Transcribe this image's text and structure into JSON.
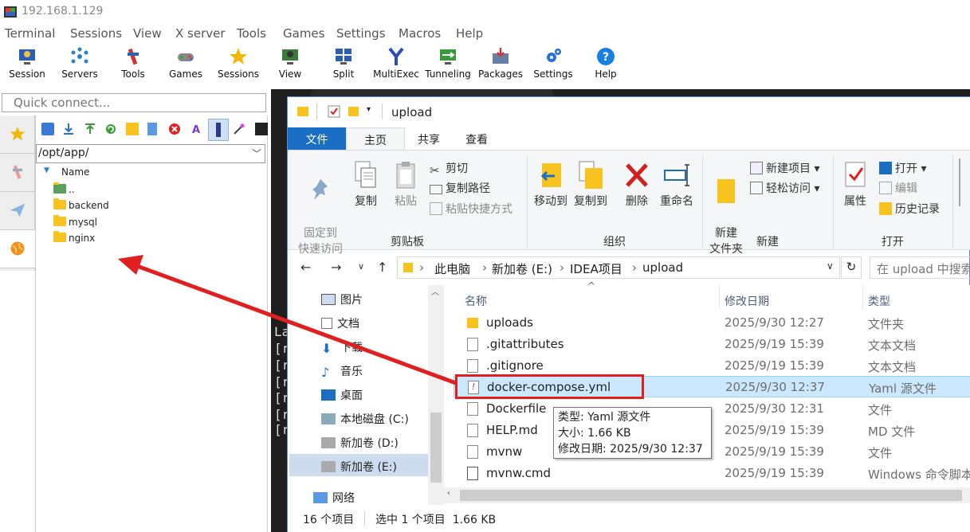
{
  "app": {
    "title": "192.168.1.129"
  },
  "menu": [
    "Terminal",
    "Sessions",
    "View",
    "X server",
    "Tools",
    "Games",
    "Settings",
    "Macros",
    "Help"
  ],
  "toolbar": [
    "Session",
    "Servers",
    "Tools",
    "Games",
    "Sessions",
    "View",
    "Split",
    "MultiExec",
    "Tunneling",
    "Packages",
    "Settings",
    "Help"
  ],
  "quick_connect": {
    "placeholder": "Quick connect..."
  },
  "sftp": {
    "path": "/opt/app/",
    "header": "Name",
    "items": [
      "..",
      "backend",
      "mysql",
      "nginx"
    ]
  },
  "terminal": {
    "lines": [
      "La",
      "[r",
      "[r",
      "[r",
      "[r",
      "[r",
      "[r"
    ]
  },
  "explorer": {
    "title": "upload",
    "tabs": [
      "文件",
      "主页",
      "共享",
      "查看"
    ],
    "clipboard": {
      "pin": "固定到\n快速访问",
      "copy": "复制",
      "paste": "粘贴",
      "cut": "剪切",
      "copy_path": "复制路径",
      "paste_shortcut": "粘贴快捷方式",
      "label": "剪贴板"
    },
    "organize": {
      "move_to": "移动到",
      "copy_to": "复制到",
      "delete": "删除",
      "rename": "重命名",
      "label": "组织"
    },
    "new": {
      "new_folder": "新建\n文件夹",
      "new_item": "新建项目",
      "easy_access": "轻松访问",
      "label": "新建"
    },
    "open": {
      "properties": "属性",
      "open": "打开",
      "edit": "编辑",
      "history": "历史记录",
      "label": "打开"
    },
    "breadcrumb": [
      "此电脑",
      "新加卷 (E:)",
      "IDEA项目",
      "upload"
    ],
    "search_placeholder": "在 upload 中搜索",
    "nav": [
      "图片",
      "文档",
      "下载",
      "音乐",
      "桌面",
      "本地磁盘 (C:)",
      "新加卷 (D:)",
      "新加卷 (E:)",
      "网络"
    ],
    "columns": {
      "name": "名称",
      "date": "修改日期",
      "type": "类型"
    },
    "files": [
      {
        "name": "uploads",
        "date": "2025/9/30 12:27",
        "type": "文件夹"
      },
      {
        "name": ".gitattributes",
        "date": "2025/9/19 15:39",
        "type": "文本文档"
      },
      {
        "name": ".gitignore",
        "date": "2025/9/19 15:39",
        "type": "文本文档"
      },
      {
        "name": "docker-compose.yml",
        "date": "2025/9/30 12:37",
        "type": "Yaml 源文件"
      },
      {
        "name": "Dockerfile",
        "date": "2025/9/30 12:31",
        "type": "文件"
      },
      {
        "name": "HELP.md",
        "date": "2025/9/19 15:39",
        "type": "MD 文件"
      },
      {
        "name": "mvnw",
        "date": "2025/9/19 15:39",
        "type": "文件"
      },
      {
        "name": "mvnw.cmd",
        "date": "2025/9/19 15:39",
        "type": "Windows 命令脚本"
      }
    ],
    "tooltip": {
      "type": "类型: Yaml 源文件",
      "size": "大小: 1.66 KB",
      "modified": "修改日期: 2025/9/30 12:37"
    },
    "status": {
      "count": "16 个项目",
      "selected": "选中 1 个项目  1.66 KB"
    }
  },
  "colors": {
    "accent": "#1a6fc4",
    "annotation": "#e02020",
    "selection": "#cce8ff"
  }
}
